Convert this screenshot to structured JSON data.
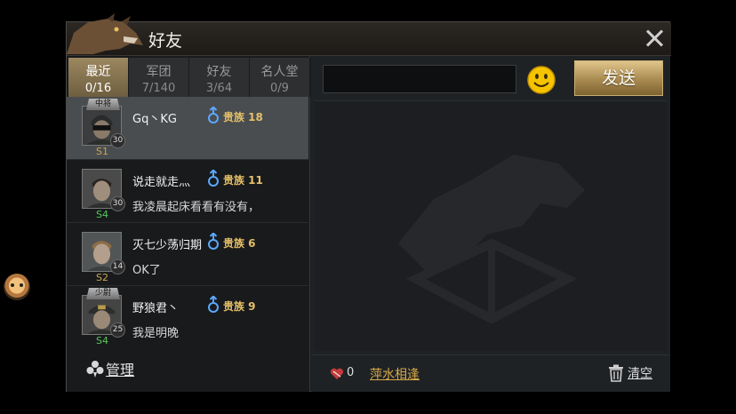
{
  "header": {
    "title": "好友"
  },
  "tabs": [
    {
      "label": "最近",
      "count": "0/16",
      "active": true
    },
    {
      "label": "军团",
      "count": "7/140",
      "active": false
    },
    {
      "label": "好友",
      "count": "3/64",
      "active": false
    },
    {
      "label": "名人堂",
      "count": "0/9",
      "active": false
    }
  ],
  "friends": [
    {
      "name": "Gq丶KG",
      "rank_badge": "中将",
      "level": "30",
      "server": "S1",
      "noble": "贵族 18",
      "message": "",
      "selected": true
    },
    {
      "name": "说走就走灬",
      "rank_badge": "",
      "level": "30",
      "server": "S4",
      "noble": "贵族 11",
      "message": "我凌晨起床看看有没有，",
      "selected": false
    },
    {
      "name": "灭七少荡归期",
      "rank_badge": "",
      "level": "14",
      "server": "S2",
      "noble": "贵族 6",
      "message": "OK了",
      "selected": false
    },
    {
      "name": "野狼君丶",
      "rank_badge": "少尉",
      "level": "25",
      "server": "S4",
      "noble": "贵族 9",
      "message": "我是明晚",
      "selected": false
    }
  ],
  "left_footer": {
    "manage_label": "管理"
  },
  "chat": {
    "input_value": "",
    "send_label": "发送",
    "heart_count": "0",
    "phrase": "萍水相逢",
    "clear_label": "清空"
  },
  "icons": {
    "close": "close-icon",
    "emoji": "smiley-icon",
    "gender": "male-icon",
    "manage": "manage-icon",
    "heart": "heart-icon",
    "trash": "trash-icon"
  },
  "colors": {
    "accent_gold": "#d6a84a",
    "noble_gold": "#e5c068",
    "gender_blue": "#5aa8ff",
    "server_green": "#58c85a"
  }
}
